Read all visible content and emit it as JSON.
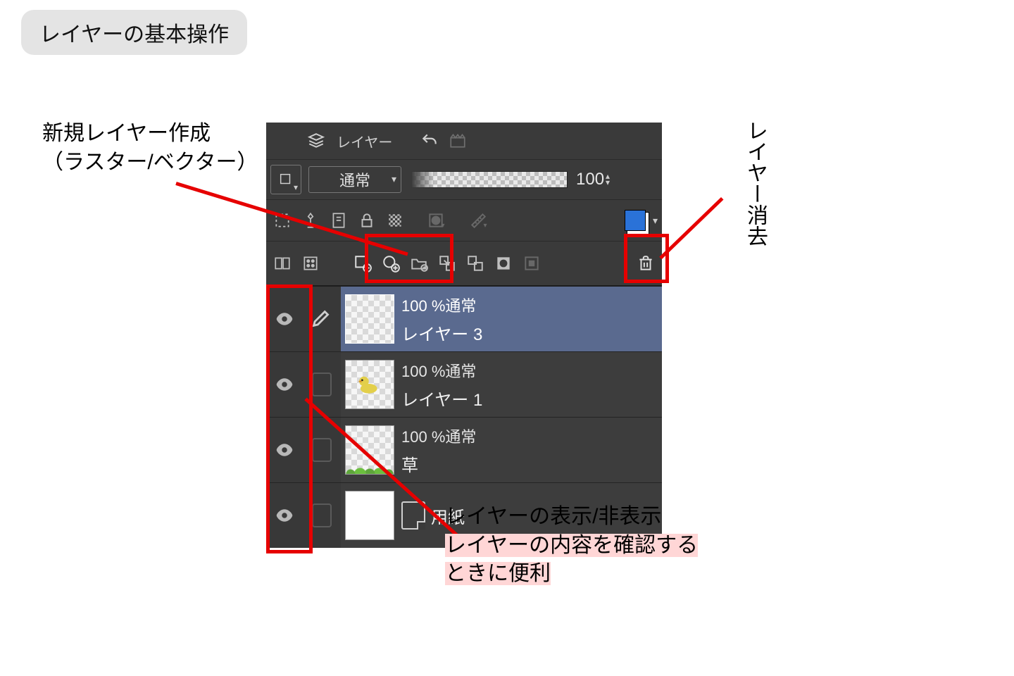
{
  "title": "レイヤーの基本操作",
  "annotations": {
    "newLayer": "新規レイヤー作成\n（ラスター/ベクター）",
    "delete": "レイヤー消去",
    "visibility": "レイヤーの表示/非表示\nレイヤーの内容を確認する\nときに便利"
  },
  "panel": {
    "tab": "レイヤー",
    "blendMode": "通常",
    "opacity": "100",
    "layers": [
      {
        "mode": "100 %通常",
        "name": "レイヤー 3",
        "selected": true,
        "thumb": "blank"
      },
      {
        "mode": "100 %通常",
        "name": "レイヤー 1",
        "selected": false,
        "thumb": "duck"
      },
      {
        "mode": "100 %通常",
        "name": "草",
        "selected": false,
        "thumb": "grass"
      },
      {
        "name": "用紙",
        "selected": false,
        "thumb": "paper"
      }
    ]
  }
}
